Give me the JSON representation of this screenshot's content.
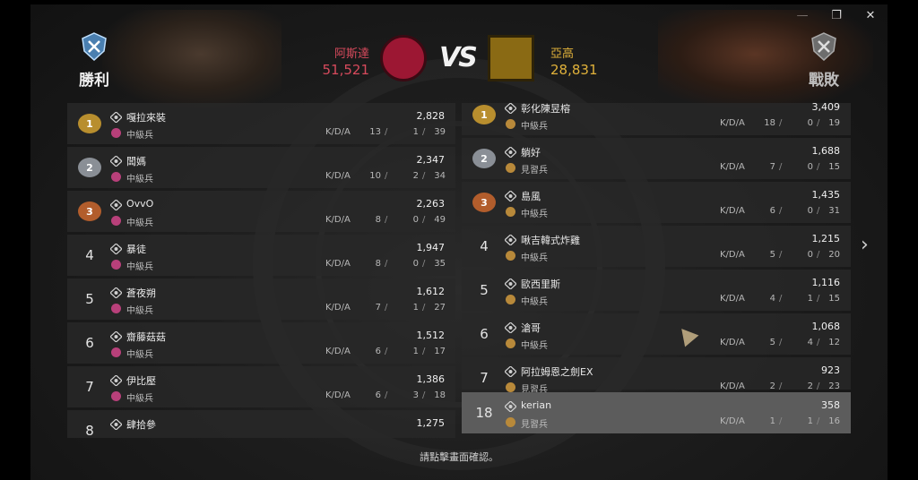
{
  "window_controls": {
    "minimize": "—",
    "restore": "❐",
    "close": "✕"
  },
  "header": {
    "left": {
      "result": "勝利",
      "team": "阿斯達",
      "score": "51,521"
    },
    "right": {
      "result": "戰敗",
      "team": "亞高",
      "score": "28,831"
    },
    "vs": "VS"
  },
  "kda_label": "K/D/A",
  "left_rows": [
    {
      "rank": "1",
      "medal": "g1",
      "name": "嘎拉來裝",
      "tier": "中級兵",
      "tier_color": "red",
      "score": "2,828",
      "k": "13",
      "d": "1",
      "a": "39"
    },
    {
      "rank": "2",
      "medal": "g2",
      "name": "闆媽",
      "tier": "中級兵",
      "tier_color": "red",
      "score": "2,347",
      "k": "10",
      "d": "2",
      "a": "34"
    },
    {
      "rank": "3",
      "medal": "g3",
      "name": "OvvO",
      "tier": "中級兵",
      "tier_color": "red",
      "score": "2,263",
      "k": "8",
      "d": "0",
      "a": "49"
    },
    {
      "rank": "4",
      "medal": "",
      "name": "暴徒",
      "tier": "中級兵",
      "tier_color": "red",
      "score": "1,947",
      "k": "8",
      "d": "0",
      "a": "35"
    },
    {
      "rank": "5",
      "medal": "",
      "name": "蒼夜朔",
      "tier": "中級兵",
      "tier_color": "red",
      "score": "1,612",
      "k": "7",
      "d": "1",
      "a": "27"
    },
    {
      "rank": "6",
      "medal": "",
      "name": "齋藤菇菇",
      "tier": "中級兵",
      "tier_color": "red",
      "score": "1,512",
      "k": "6",
      "d": "1",
      "a": "17"
    },
    {
      "rank": "7",
      "medal": "",
      "name": "伊比壓",
      "tier": "中級兵",
      "tier_color": "red",
      "score": "1,386",
      "k": "6",
      "d": "3",
      "a": "18"
    },
    {
      "rank": "8",
      "medal": "",
      "name": "肆拾參",
      "tier": "",
      "tier_color": "red",
      "score": "1,275",
      "k": "",
      "d": "",
      "a": ""
    }
  ],
  "right_rows": [
    {
      "rank": "1",
      "medal": "g1",
      "name": "彰化陳昱榕",
      "tier": "中級兵",
      "tier_color": "gold",
      "score": "3,409",
      "k": "18",
      "d": "0",
      "a": "19"
    },
    {
      "rank": "2",
      "medal": "g2",
      "name": "躺好",
      "tier": "見習兵",
      "tier_color": "gold",
      "score": "1,688",
      "k": "7",
      "d": "0",
      "a": "15"
    },
    {
      "rank": "3",
      "medal": "g3",
      "name": "島風",
      "tier": "中級兵",
      "tier_color": "gold",
      "score": "1,435",
      "k": "6",
      "d": "0",
      "a": "31"
    },
    {
      "rank": "4",
      "medal": "",
      "name": "啾吉韓式炸雞",
      "tier": "中級兵",
      "tier_color": "gold",
      "score": "1,215",
      "k": "5",
      "d": "0",
      "a": "20"
    },
    {
      "rank": "5",
      "medal": "",
      "name": "歐西里斯",
      "tier": "中級兵",
      "tier_color": "gold",
      "score": "1,116",
      "k": "4",
      "d": "1",
      "a": "15"
    },
    {
      "rank": "6",
      "medal": "",
      "name": "滄哥",
      "tier": "中級兵",
      "tier_color": "gold",
      "score": "1,068",
      "k": "5",
      "d": "4",
      "a": "12"
    },
    {
      "rank": "7",
      "medal": "",
      "name": "阿拉姆恩之劍EX",
      "tier": "見習兵",
      "tier_color": "gold",
      "score": "923",
      "k": "2",
      "d": "2",
      "a": "23"
    }
  ],
  "self_row": {
    "rank": "18",
    "name": "kerian",
    "tier": "見習兵",
    "tier_color": "gold",
    "score": "358",
    "k": "1",
    "d": "1",
    "a": "16"
  },
  "footer": "請點擊畫面確認。",
  "next_arrow": "›"
}
